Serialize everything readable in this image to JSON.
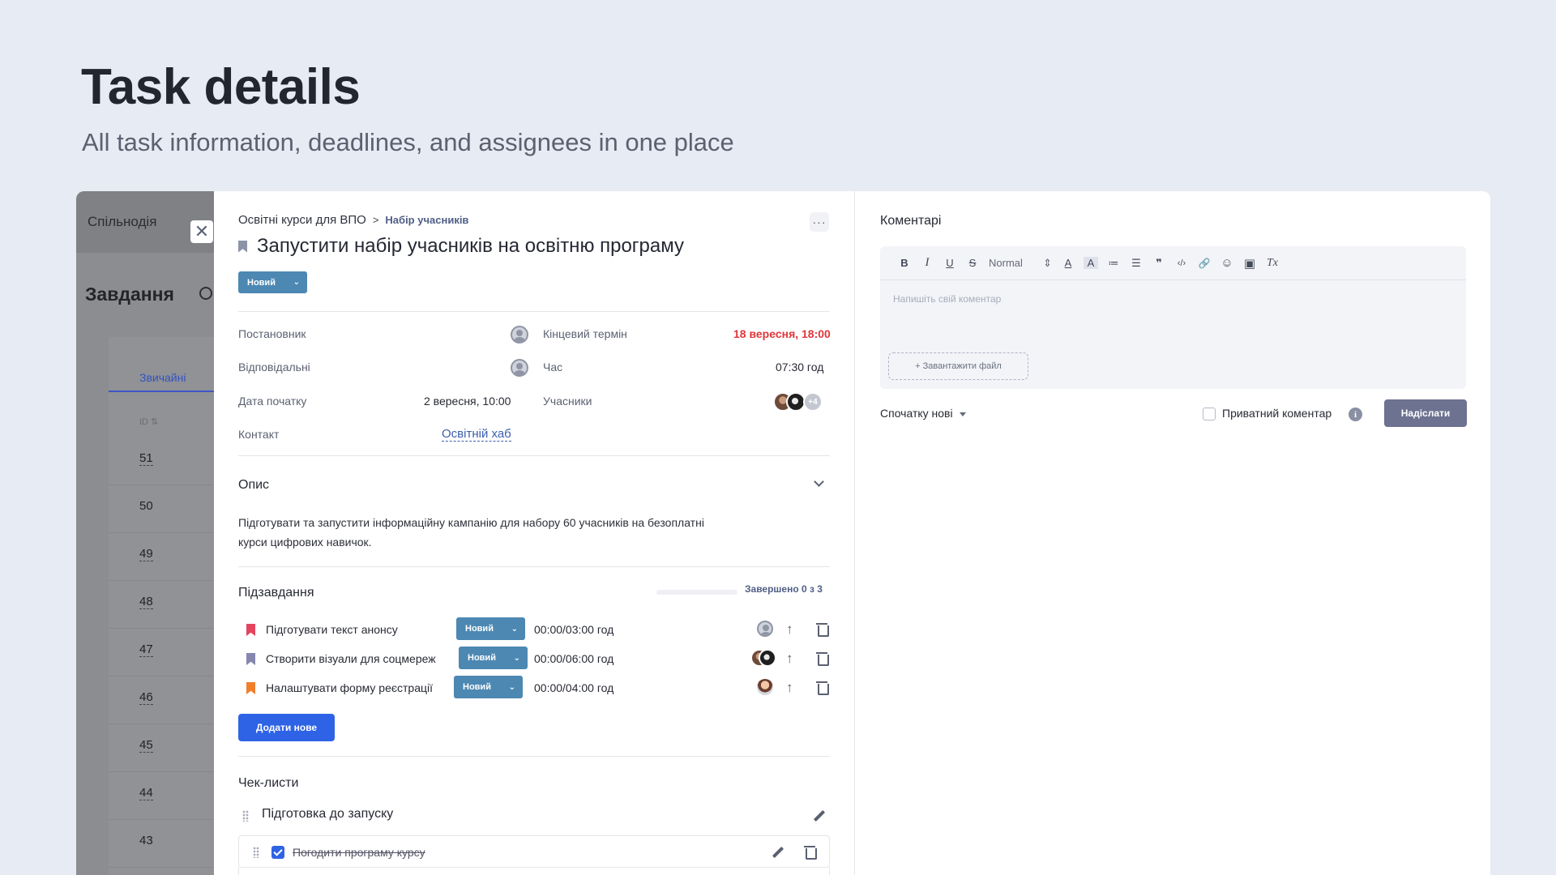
{
  "hero": {
    "title": "Task details",
    "subtitle": "All task information, deadlines, and assignees in one place"
  },
  "background_app": {
    "org_name": "Спільнодія",
    "heading": "Завдання",
    "tab": "Звичайні",
    "sort_hint": "ID ⇅",
    "rows": [
      "51",
      "50",
      "49",
      "48",
      "47",
      "46",
      "45",
      "44",
      "43"
    ]
  },
  "task": {
    "breadcrumb": [
      "Освітні курси для ВПО",
      "Набір учасників"
    ],
    "breadcrumb_sep": ">",
    "more": "···",
    "title": "Запустити набір учасників на освітню програму",
    "status": "Новий",
    "fields": {
      "creator_label": "Постановник",
      "responsible_label": "Відповідальні",
      "start_label": "Дата початку",
      "start_value": "2 вересня, 10:00",
      "contact_label": "Контакт",
      "contact_value": "Освітній хаб",
      "deadline_label": "Кінцевий термін",
      "deadline_value": "18 вересня, 18:00",
      "time_label": "Час",
      "time_value": "07:30 год",
      "participants_label": "Учасники",
      "participants_more": "+4"
    },
    "description": {
      "title": "Опис",
      "text": "Підготувати та запустити інформаційну кампанію для набору 60 учасників на безоплатні курси цифрових навичок."
    },
    "subtasks": {
      "title": "Підзавдання",
      "progress_label": "Завершено 0 з 3",
      "progress_fraction": 0,
      "items": [
        {
          "name": "Підготувати текст анонсу",
          "status": "Новий",
          "time": "00:00/03:00 год",
          "color": "#e3455f"
        },
        {
          "name": "Створити візуали для соцмереж",
          "status": "Новий",
          "time": "00:00/06:00 год",
          "color": "#8687ae"
        },
        {
          "name": "Налаштувати форму реєстрації",
          "status": "Новий",
          "time": "00:00/04:00 год",
          "color": "#f07f2c"
        }
      ],
      "add_label": "Додати нове"
    },
    "checklists": {
      "title": "Чек-листи",
      "group": "Підготовка до запуску",
      "items": [
        {
          "text": "Погодити програму курсу",
          "done": true
        }
      ]
    }
  },
  "comments": {
    "title": "Коментарі",
    "toolbar": {
      "bold": "B",
      "italic": "I",
      "underline": "U",
      "strike": "S",
      "style_select": "Normal",
      "style_select_arrows": "⇕",
      "font_color": "A",
      "highlight": "A",
      "ordered_list": "≔",
      "bullet_list": "☰",
      "quote": "❞",
      "code": "‹/›",
      "link": "🔗",
      "emoji": "☺",
      "image": "▣",
      "clear": "Tx"
    },
    "placeholder": "Напишіть свій коментар",
    "upload_label": "+ Завантажити файл",
    "sort_label": "Спочатку нові",
    "private_label": "Приватний коментар",
    "info_glyph": "i",
    "send_label": "Надіслати"
  },
  "colors": {
    "status": "#4c88b2",
    "primary": "#2e63e6",
    "deadline": "#e0363a",
    "send": "#6c7290"
  }
}
